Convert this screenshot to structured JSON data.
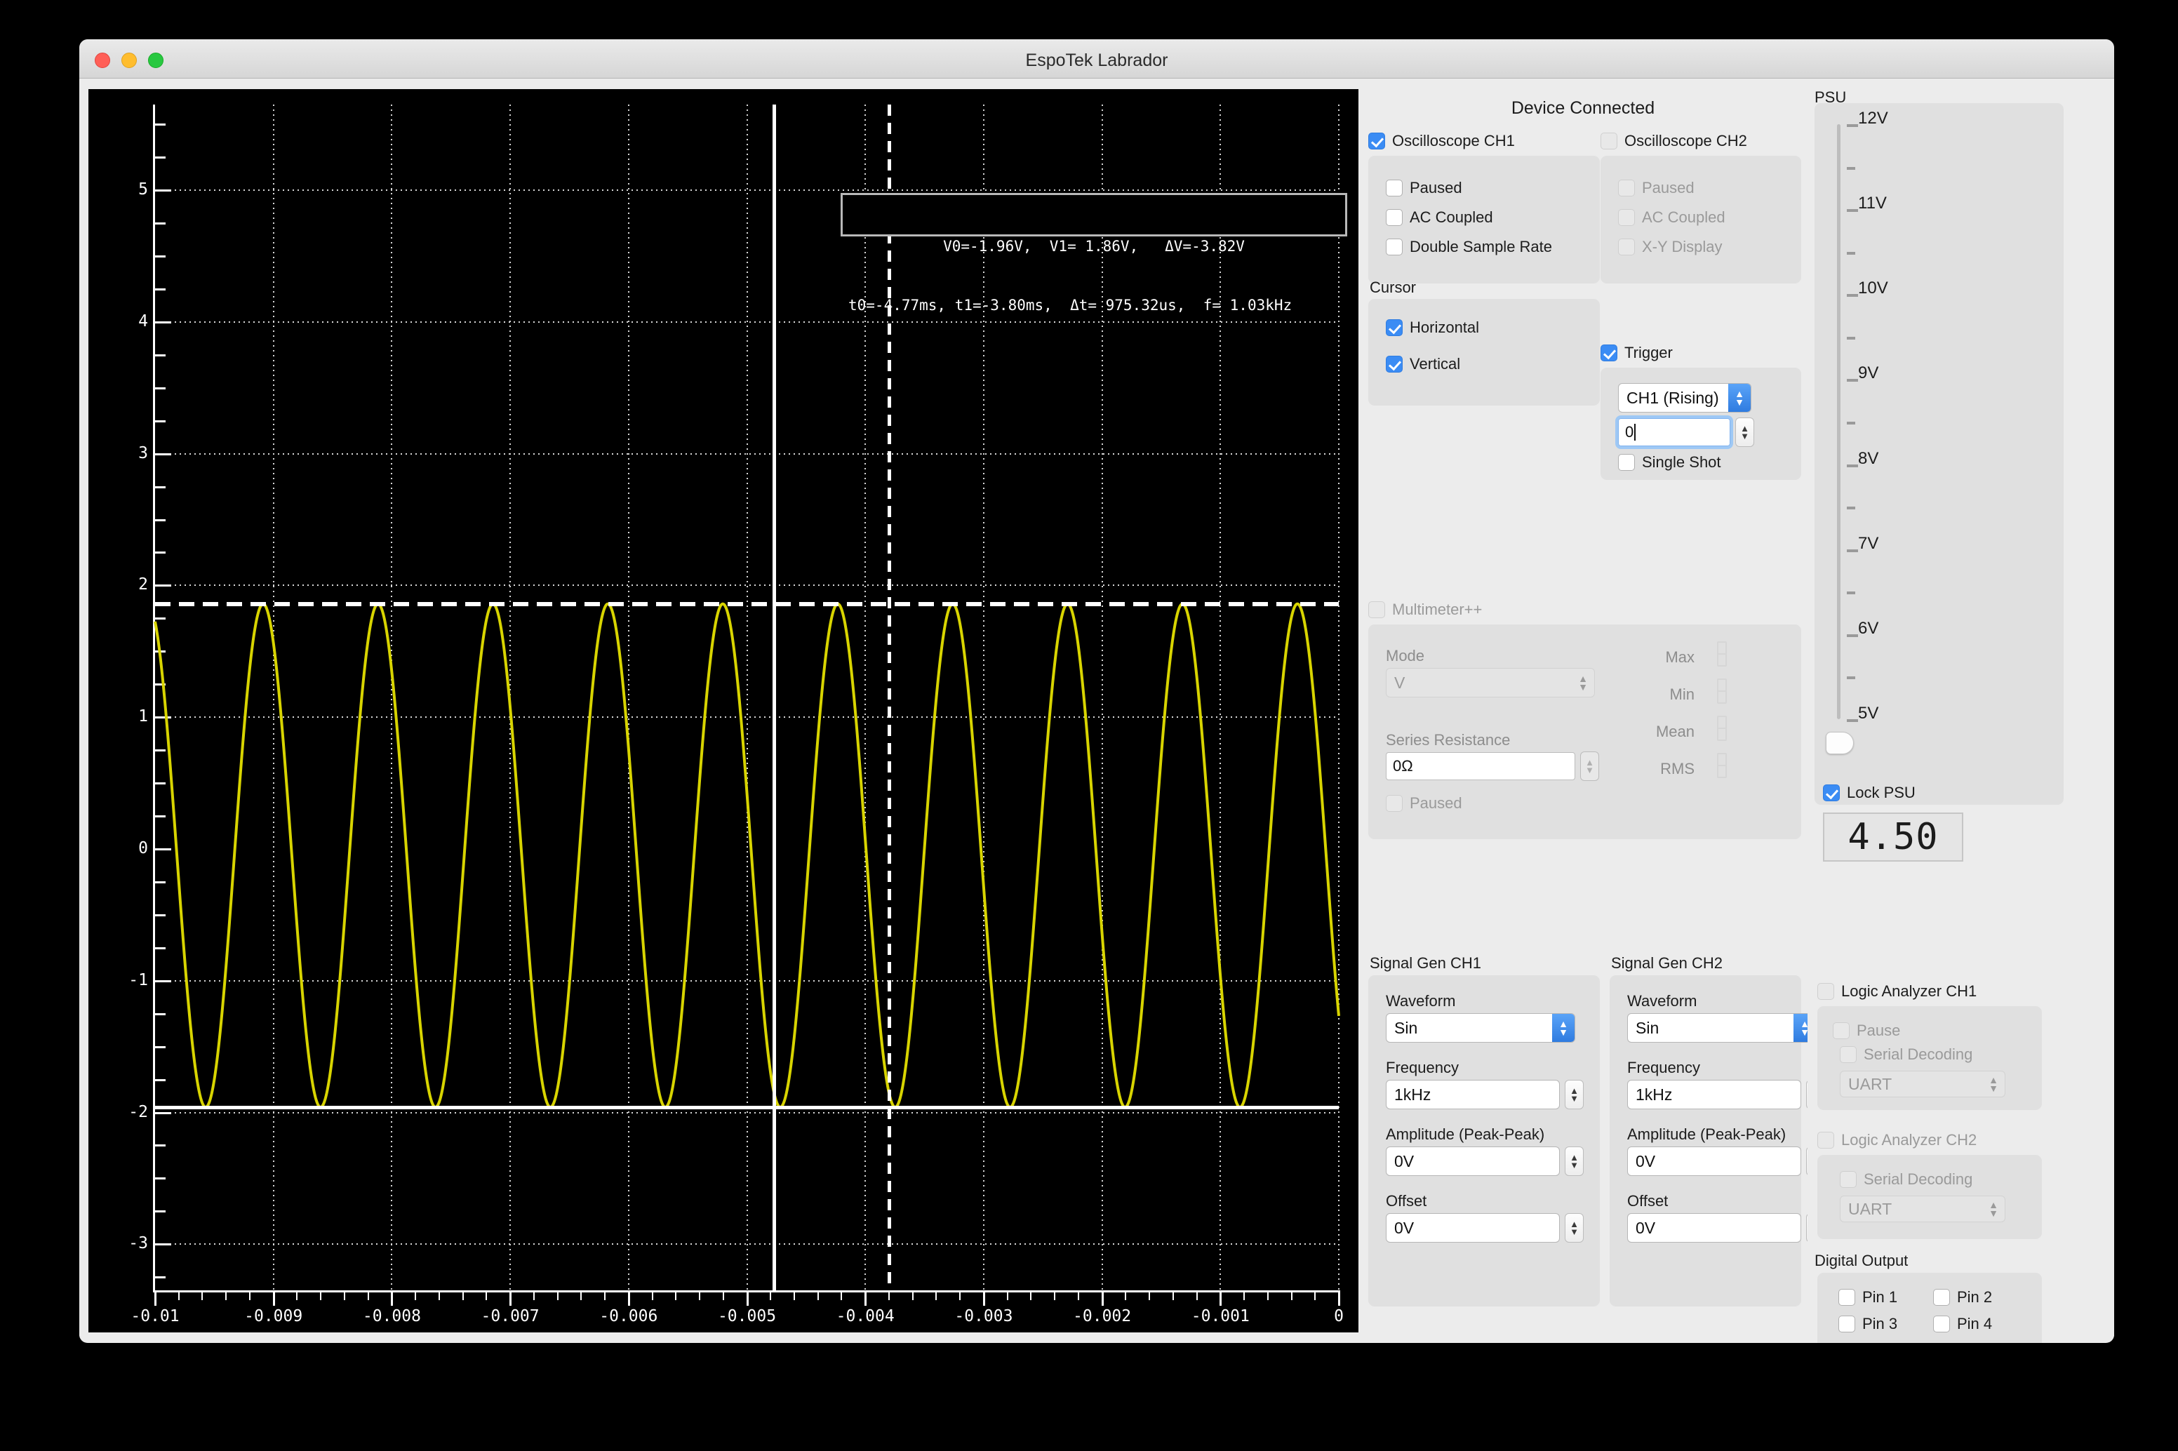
{
  "window": {
    "title": "EspoTek Labrador",
    "traffic_lights": [
      "close",
      "minimize",
      "maximize"
    ]
  },
  "scope": {
    "readout_line1": "V0=-1.96V,  V1= 1.86V,   ΔV=-3.82V",
    "readout_line2": "t0=-4.77ms, t1=-3.80ms,  Δt= 975.32us,  f= 1.03kHz",
    "cursors": {
      "v0": -1.96,
      "v1": 1.86,
      "dv": -3.82,
      "t0": -0.00477,
      "t1": -0.0038,
      "dt": 0.00097532,
      "f": 1030
    }
  },
  "chart_data": {
    "type": "line",
    "title": "",
    "xlabel": "",
    "ylabel": "",
    "xlim": [
      -0.01,
      0
    ],
    "ylim": [
      -3.35,
      5.65
    ],
    "grid": true,
    "trace_color": "#d8d400",
    "background": "#000000",
    "x_ticks": [
      -0.01,
      -0.009,
      -0.008,
      -0.007,
      -0.006,
      -0.005,
      -0.004,
      -0.003,
      -0.002,
      -0.001,
      0
    ],
    "x_tick_labels": [
      "-0.01",
      "-0.009",
      "-0.008",
      "-0.007",
      "-0.006",
      "-0.005",
      "-0.004",
      "-0.003",
      "-0.002",
      "-0.001",
      "0"
    ],
    "y_ticks": [
      5,
      4,
      3,
      2,
      1,
      0,
      -1,
      -2,
      -3
    ],
    "y_tick_labels": [
      "5",
      "4",
      "3",
      "2",
      "1",
      "0",
      "-1",
      "-2",
      "-3"
    ],
    "series": [
      {
        "name": "CH1",
        "waveform": "sine",
        "amplitude": 1.91,
        "offset": -0.05,
        "frequency_hz": 1030,
        "phase_deg": 0,
        "peak_v": 1.86,
        "trough_v": -1.96
      }
    ],
    "annotations": {
      "cursor_h_solid_y": -1.96,
      "cursor_h_dashed_y": 1.86,
      "cursor_v_solid_x": -0.00477,
      "cursor_v_dashed_x": -0.0038
    }
  },
  "controls": {
    "device_status": "Device Connected",
    "osc_ch1": {
      "title": "Oscilloscope CH1",
      "enabled": true,
      "paused": "Paused",
      "paused_checked": false,
      "ac_coupled": "AC Coupled",
      "ac_coupled_checked": false,
      "double_sample_rate": "Double Sample Rate",
      "double_sample_rate_checked": false
    },
    "osc_ch2": {
      "title": "Oscilloscope CH2",
      "enabled": false,
      "paused": "Paused",
      "ac_coupled": "AC Coupled",
      "xy_display": "X-Y Display"
    },
    "cursor": {
      "title": "Cursor",
      "horizontal": "Horizontal",
      "horizontal_checked": true,
      "vertical": "Vertical",
      "vertical_checked": true
    },
    "trigger": {
      "title": "Trigger",
      "enabled": true,
      "source": "CH1 (Rising)",
      "level": "0",
      "single_shot": "Single Shot",
      "single_shot_checked": false
    },
    "multimeter": {
      "title": "Multimeter++",
      "enabled": false,
      "mode_label": "Mode",
      "mode_value": "V",
      "series_resistance_label": "Series Resistance",
      "series_resistance_value": "0Ω",
      "paused": "Paused",
      "stats": [
        {
          "label": "Max",
          "value": ""
        },
        {
          "label": "Min",
          "value": ""
        },
        {
          "label": "Mean",
          "value": ""
        },
        {
          "label": "RMS",
          "value": ""
        }
      ]
    },
    "siggen_ch1": {
      "title": "Signal Gen CH1",
      "waveform_label": "Waveform",
      "waveform_value": "Sin",
      "frequency_label": "Frequency",
      "frequency_value": "1kHz",
      "amplitude_label": "Amplitude (Peak-Peak)",
      "amplitude_value": "0V",
      "offset_label": "Offset",
      "offset_value": "0V"
    },
    "siggen_ch2": {
      "title": "Signal Gen CH2",
      "waveform_label": "Waveform",
      "waveform_value": "Sin",
      "frequency_label": "Frequency",
      "frequency_value": "1kHz",
      "amplitude_label": "Amplitude (Peak-Peak)",
      "amplitude_value": "0V",
      "offset_label": "Offset",
      "offset_value": "0V"
    }
  },
  "psu": {
    "title": "PSU",
    "tick_labels": [
      "12V",
      "11V",
      "10V",
      "9V",
      "8V",
      "7V",
      "6V",
      "5V"
    ],
    "lock_label": "Lock PSU",
    "lock_checked": true,
    "display_value": "4.50",
    "slider_value": 4.5
  },
  "logic_analyzer_ch1": {
    "title": "Logic Analyzer CH1",
    "enabled": false,
    "pause": "Pause",
    "serial_decoding": "Serial Decoding",
    "protocol": "UART"
  },
  "logic_analyzer_ch2": {
    "title": "Logic Analyzer CH2",
    "enabled": false,
    "serial_decoding": "Serial Decoding",
    "protocol": "UART"
  },
  "digital_output": {
    "title": "Digital Output",
    "pins": [
      "Pin 1",
      "Pin 2",
      "Pin 3",
      "Pin 4"
    ],
    "swatch_colors": [
      "#ffffff",
      "#000000",
      "#ea1c24"
    ]
  },
  "colors": {
    "accent": "#3b8cf4",
    "trace": "#d8d400",
    "panel": "#ececec",
    "group": "#e0e0e0",
    "scope_bg": "#000000",
    "led_red": "#ea1c24"
  }
}
